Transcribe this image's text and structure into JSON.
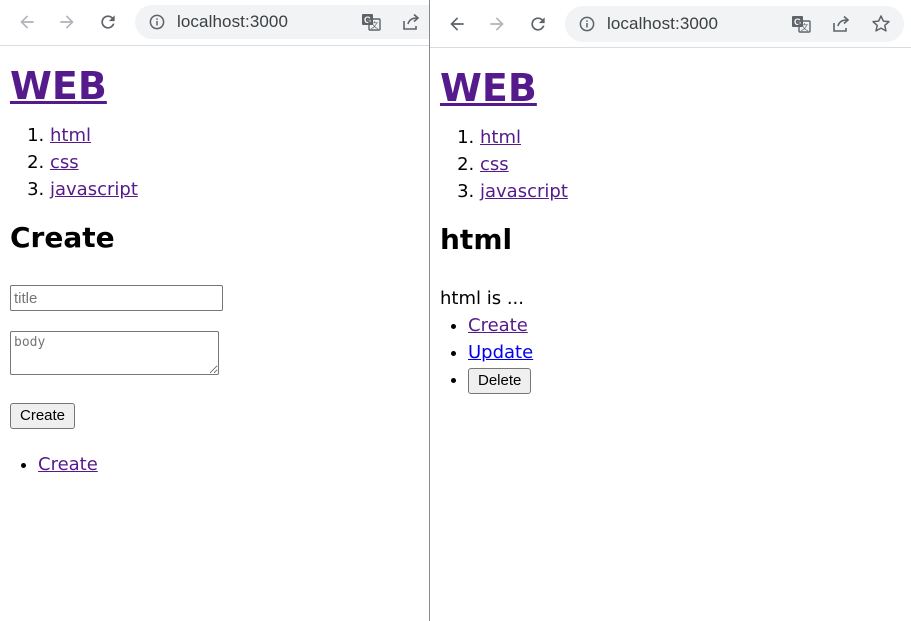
{
  "left_window": {
    "url": "localhost:3000",
    "site_title": "WEB",
    "topics": [
      {
        "label": "html"
      },
      {
        "label": "css"
      },
      {
        "label": "javascript"
      }
    ],
    "heading": "Create",
    "form": {
      "title_placeholder": "title",
      "body_placeholder": "body",
      "submit_label": "Create"
    },
    "controls": [
      {
        "label": "Create"
      }
    ]
  },
  "right_window": {
    "url": "localhost:3000",
    "site_title": "WEB",
    "topics": [
      {
        "label": "html"
      },
      {
        "label": "css"
      },
      {
        "label": "javascript"
      }
    ],
    "heading": "html",
    "body_text": "html is ...",
    "controls": [
      {
        "label": "Create"
      },
      {
        "label": "Update"
      },
      {
        "label": "Delete"
      }
    ]
  },
  "icons": {
    "back": "arrow-left-icon",
    "forward": "arrow-right-icon",
    "reload": "reload-icon",
    "info": "info-icon",
    "translate": "translate-icon",
    "share": "share-icon",
    "bookmark": "star-icon"
  },
  "colors": {
    "visited_link": "#551a8b",
    "unvisited_link": "#0000ee",
    "omnibox_bg": "#f1f3f4"
  }
}
